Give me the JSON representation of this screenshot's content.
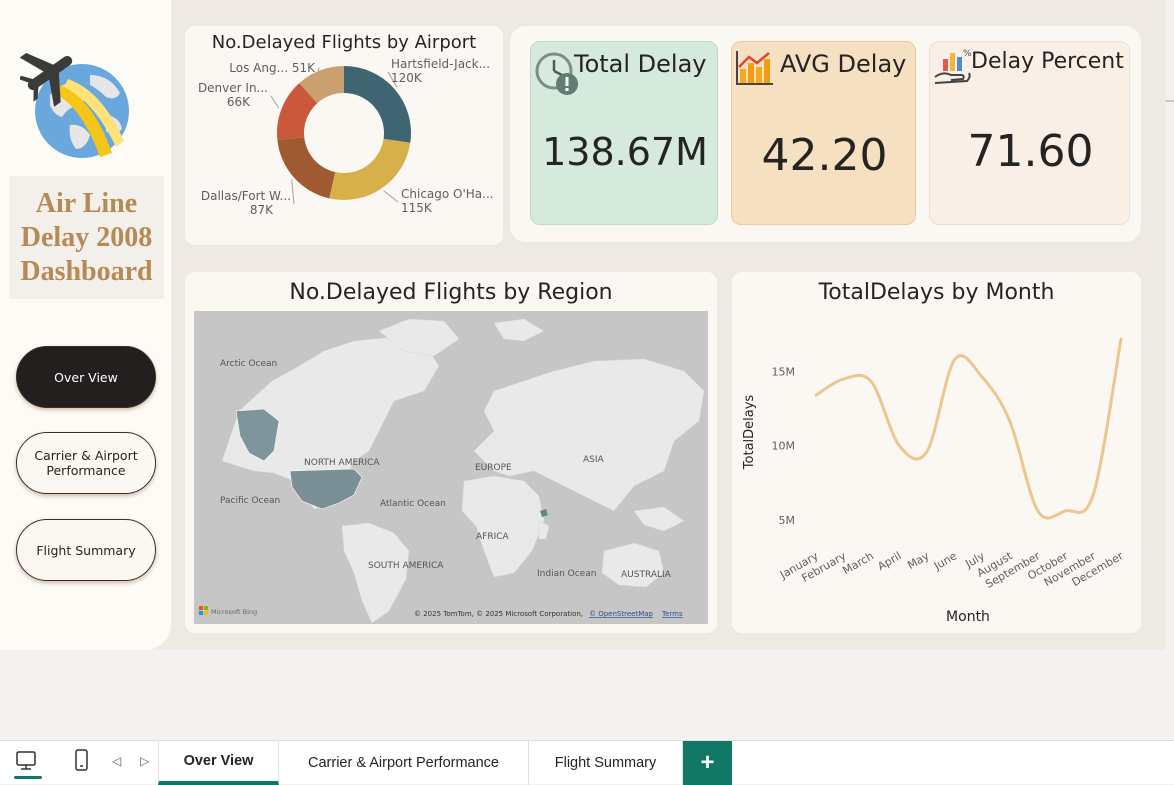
{
  "sidebar": {
    "dashboard_title": "Air Line Delay 2008 Dashboard",
    "nav": [
      {
        "label": "Over View",
        "active": true
      },
      {
        "label": "Carrier & Airport Performance",
        "active": false
      },
      {
        "label": "Flight Summary",
        "active": false
      }
    ]
  },
  "donut": {
    "title": "No.Delayed Flights by Airport",
    "slices": [
      {
        "label": "Hartsfield-Jack...",
        "value_label": "120K",
        "value": 120,
        "color": "#3e6571"
      },
      {
        "label": "Chicago O'Ha...",
        "value_label": "115K",
        "value": 115,
        "color": "#d8b04a"
      },
      {
        "label": "Dallas/Fort W...",
        "value_label": "87K",
        "value": 87,
        "color": "#a05a32"
      },
      {
        "label": "Denver In...",
        "value_label": "66K",
        "value": 66,
        "color": "#c9593a"
      },
      {
        "label": "Los Ang...",
        "value_label": "51K",
        "value": 51,
        "color": "#c9a070"
      }
    ]
  },
  "kpis": [
    {
      "title": "Total Delay",
      "value": "138.67M",
      "bg": "#d5e9dc",
      "icon": "clock-alert-icon"
    },
    {
      "title": "AVG Delay",
      "value": "42.20",
      "bg": "#f6e0c2",
      "icon": "bar-chart-icon"
    },
    {
      "title": "Delay Percent",
      "value": "71.60",
      "bg": "#faefe7",
      "icon": "hand-chart-icon"
    }
  ],
  "map": {
    "title": "No.Delayed Flights by Region",
    "labels": {
      "arctic": "Arctic Ocean",
      "na": "NORTH AMERICA",
      "europe": "EUROPE",
      "asia": "ASIA",
      "pacific": "Pacific Ocean",
      "atlantic": "Atlantic Ocean",
      "africa": "AFRICA",
      "sa": "SOUTH AMERICA",
      "indian": "Indian Ocean",
      "australia": "AUSTRALIA"
    },
    "bing": "Microsoft Bing",
    "copyright": "© 2025 TomTom, © 2025 Microsoft Corporation,",
    "osm": "© OpenStreetMap",
    "terms": "Terms"
  },
  "chart_data": {
    "type": "line",
    "title": "TotalDelays by Month",
    "xlabel": "Month",
    "ylabel": "TotalDelays",
    "categories": [
      "January",
      "February",
      "March",
      "April",
      "May",
      "June",
      "July",
      "August",
      "September",
      "October",
      "November",
      "December"
    ],
    "series": [
      {
        "values": [
          13.4,
          14.5,
          14.3,
          10.0,
          9.6,
          15.8,
          14.6,
          11.6,
          5.6,
          5.6,
          6.7,
          17.2
        ],
        "color": "#ecc68e"
      }
    ],
    "yticks": [
      {
        "v": 5,
        "label": "5M"
      },
      {
        "v": 10,
        "label": "10M"
      },
      {
        "v": 15,
        "label": "15M"
      }
    ],
    "ylim": [
      3.5,
      18.0
    ],
    "grid": false
  },
  "tabs": {
    "items": [
      "Over View",
      "Carrier & Airport Performance",
      "Flight Summary"
    ],
    "active": "Over View",
    "add": "+"
  }
}
